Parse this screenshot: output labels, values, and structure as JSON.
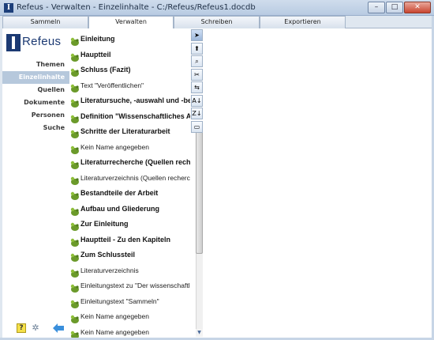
{
  "window": {
    "title": "Refeus - Verwalten - Einzelinhalte - C:/Refeus/Refeus1.docdb",
    "minimize": "–",
    "maximize": "□",
    "close": "✕"
  },
  "tabs": [
    {
      "label": "Sammeln"
    },
    {
      "label": "Verwalten",
      "active": true
    },
    {
      "label": "Schreiben"
    },
    {
      "label": "Exportieren"
    }
  ],
  "logo": {
    "text": "Refeus"
  },
  "sidebar": {
    "items": [
      {
        "label": "Themen"
      },
      {
        "label": "Einzelinhalte",
        "selected": true
      },
      {
        "label": "Quellen"
      },
      {
        "label": "Dokumente"
      },
      {
        "label": "Personen"
      },
      {
        "label": "Suche"
      }
    ],
    "help_label": "?"
  },
  "list": {
    "items": [
      {
        "text": "Einleitung",
        "bold": true
      },
      {
        "text": "Hauptteil",
        "bold": true
      },
      {
        "text": "Schluss (Fazit)",
        "bold": true
      },
      {
        "text": "Text \"Veröffentlichen\"",
        "bold": false
      },
      {
        "text": "Literatursuche, -auswahl und -be",
        "bold": true
      },
      {
        "text": "Definition \"Wissenschaftliches Ar",
        "bold": true
      },
      {
        "text": "Schritte der Literaturarbeit",
        "bold": true
      },
      {
        "text": "Kein Name angegeben",
        "bold": false
      },
      {
        "text": "Literaturrecherche (Quellen recher",
        "bold": true
      },
      {
        "text": "Literaturverzeichnis (Quellen recherch",
        "bold": false
      },
      {
        "text": "Bestandteile der Arbeit",
        "bold": true
      },
      {
        "text": "Aufbau und Gliederung",
        "bold": true
      },
      {
        "text": "Zur Einleitung",
        "bold": true
      },
      {
        "text": "Hauptteil - Zu den Kapiteln",
        "bold": true
      },
      {
        "text": "Zum Schlussteil",
        "bold": true
      },
      {
        "text": "Literaturverzeichnis",
        "bold": false
      },
      {
        "text": "Einleitungstext zu \"Der wissenschaftl",
        "bold": false
      },
      {
        "text": "Einleitungstext \"Sammeln\"",
        "bold": false
      },
      {
        "text": "Kein Name angegeben",
        "bold": false
      },
      {
        "text": "Kein Name angegeben",
        "bold": false
      }
    ]
  },
  "toolbar": {
    "tools": [
      {
        "icon": "pointer-arrow-icon",
        "glyph": "➤"
      },
      {
        "icon": "arrow-up-icon",
        "glyph": "⬆"
      },
      {
        "icon": "search-icon",
        "glyph": "⌕"
      },
      {
        "icon": "scissors-icon",
        "glyph": "✂"
      },
      {
        "icon": "refresh-icon",
        "glyph": "⇆"
      },
      {
        "icon": "sort-az-icon",
        "glyph": "A↓"
      },
      {
        "icon": "sort-za-icon",
        "glyph": "Z↓"
      },
      {
        "icon": "note-icon",
        "glyph": "▭"
      }
    ],
    "scroll_down_glyph": "▼"
  },
  "colors": {
    "selection": "#b6c8dc",
    "brand": "#1c3a73",
    "item_icon_green": "#6b9a2a"
  }
}
